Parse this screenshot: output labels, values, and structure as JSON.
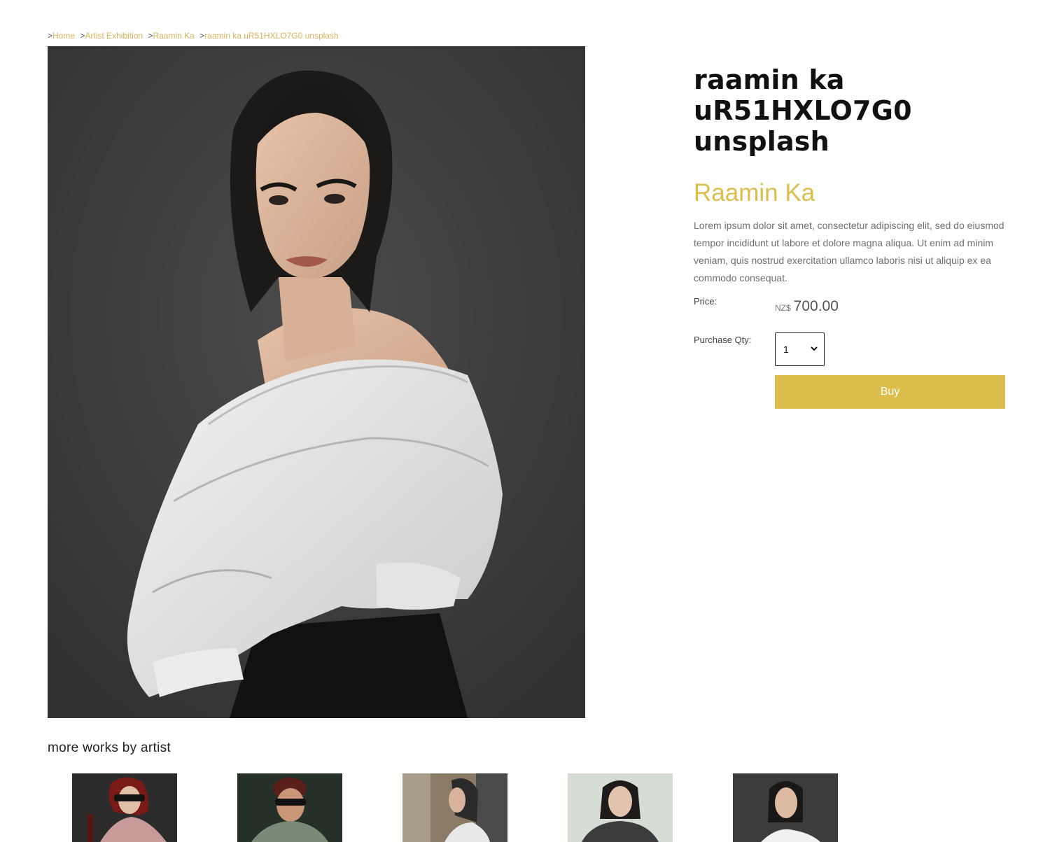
{
  "breadcrumb": {
    "items": [
      {
        "sep": ">",
        "label": "Home"
      },
      {
        "sep": ">",
        "label": "Artist Exhibition"
      },
      {
        "sep": ">",
        "label": "Raamin Ka"
      },
      {
        "sep": ">",
        "label": "raamin ka uR51HXLO7G0 unsplash"
      }
    ]
  },
  "product": {
    "title_line1": "raamin ka",
    "title_line2": "uR51HXLO7G0",
    "title_line3": "unsplash",
    "artist": "Raamin Ka",
    "description": "Lorem ipsum dolor sit amet, consectetur adipiscing elit, sed do eiusmod tempor incididunt ut labore et dolore magna aliqua. Ut enim ad minim veniam, quis nostrud exercitation ullamco laboris nisi ut aliquip ex ea commodo consequat.",
    "price_label": "Price:",
    "currency": "NZ$",
    "price": "700.00",
    "qty_label": "Purchase Qty:",
    "qty_value": "1",
    "buy_label": "Buy"
  },
  "more": {
    "heading": "more works by artist"
  },
  "colors": {
    "accent": "#ddbd4c",
    "link": "#d6b45a"
  }
}
